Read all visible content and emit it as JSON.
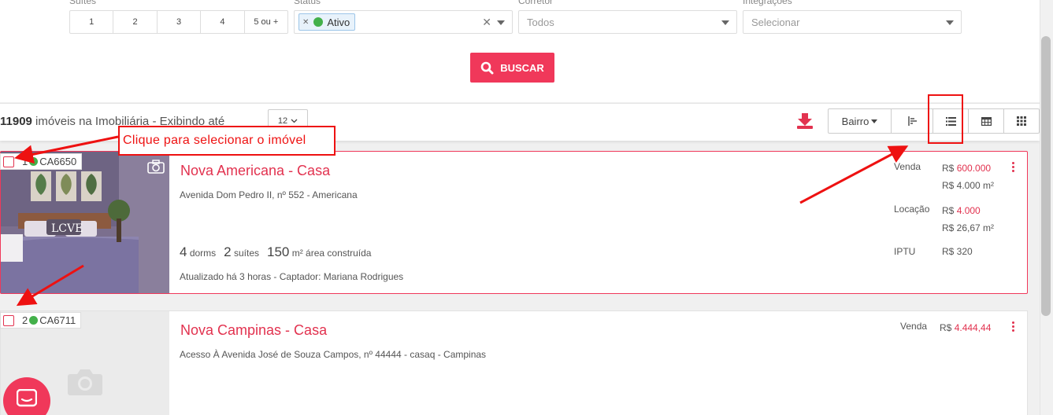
{
  "filters": {
    "suites_label": "Suítes",
    "suites": [
      "1",
      "2",
      "3",
      "4",
      "5 ou +"
    ],
    "status_label": "Status",
    "status_tag": "Ativo",
    "corretor_label": "Corretor",
    "corretor_value": "Todos",
    "integracoes_label": "Integrações",
    "integracoes_placeholder": "Selecionar",
    "search_button": "BUSCAR"
  },
  "results": {
    "count": "11909",
    "count_text": " imóveis na Imobiliária - Exibindo até",
    "per_page": "12",
    "sort_label": "Bairro"
  },
  "annotation": {
    "note": "Clique para selecionar o imóvel"
  },
  "listings": [
    {
      "index": "1",
      "code": "CA6650",
      "title": "Nova Americana - Casa",
      "address": "Avenida Dom Pedro II, nº 552 - Americana",
      "dorms": "4",
      "dorms_label": "dorms",
      "suites": "2",
      "suites_label": "suítes",
      "area": "150",
      "area_label": "m² área construída",
      "updated": "Atualizado há 3 horas - Captador: Mariana Rodrigues",
      "venda_label": "Venda",
      "venda_currency": "R$ ",
      "venda_value": "600.000",
      "venda_m2": "R$ 4.000 m²",
      "locacao_label": "Locação",
      "locacao_currency": "R$ ",
      "locacao_value": "4.000",
      "locacao_m2": "R$ 26,67 m²",
      "iptu_label": "IPTU",
      "iptu_value": "R$ 320"
    },
    {
      "index": "2",
      "code": "CA6711",
      "title": "Nova Campinas - Casa",
      "address": "Acesso À Avenida José de Souza Campos, nº 44444 - casaq - Campinas",
      "venda_label": "Venda",
      "venda_currency": "R$ ",
      "venda_value": "4.444,44"
    }
  ],
  "colors": {
    "accent": "#f0385a",
    "status_green": "#43b04a",
    "annotation_red": "#ee1111"
  }
}
